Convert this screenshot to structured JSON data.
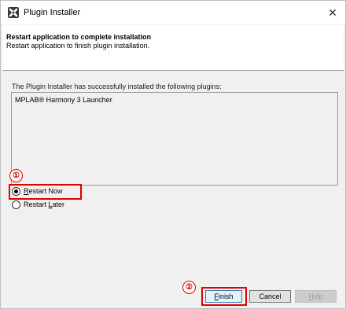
{
  "window": {
    "title": "Plugin Installer",
    "icon": "plugin-installer-icon",
    "close_glyph": "✕"
  },
  "header": {
    "title": "Restart application to complete installation",
    "description": "Restart application to finish plugin installation."
  },
  "main": {
    "success_message": "The Plugin Installer has successfully installed the following plugins:",
    "plugins": [
      "MPLAB® Harmony 3 Launcher"
    ]
  },
  "options": {
    "restart_now": {
      "mnemonic": "R",
      "rest": "estart Now",
      "selected": true
    },
    "restart_later": {
      "prefix": "Restart ",
      "mnemonic": "L",
      "rest": "ater",
      "selected": false
    }
  },
  "buttons": {
    "finish": {
      "mnemonic": "F",
      "rest": "inish"
    },
    "cancel": "Cancel",
    "help": {
      "mnemonic": "H",
      "rest": "elp",
      "enabled": false
    }
  },
  "annotations": {
    "marker_1": "①",
    "marker_2": "②",
    "highlight_color": "#e00000"
  }
}
